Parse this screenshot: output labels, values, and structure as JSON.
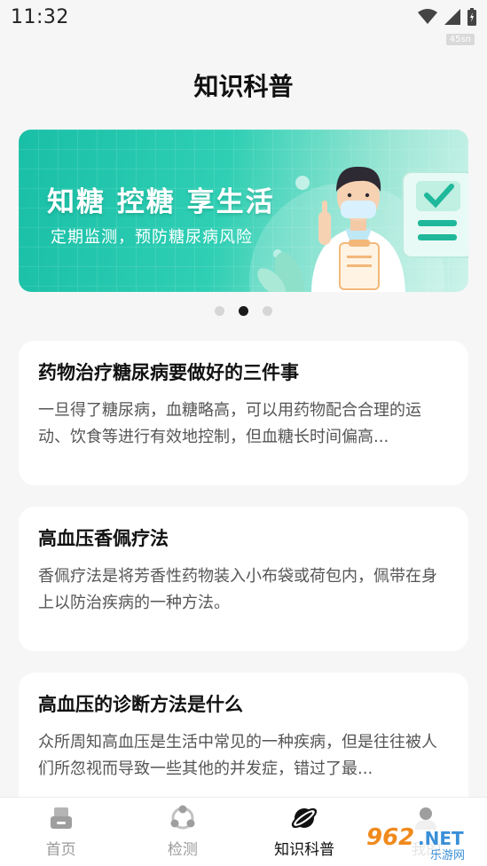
{
  "status_bar": {
    "time": "11:32",
    "badge": "45sn"
  },
  "page": {
    "title": "知识科普"
  },
  "banner": {
    "headline": "知糖 控糖 享生活",
    "subtitle": "定期监测，预防糖尿病风险",
    "accent": "#1fc4aa"
  },
  "carousel": {
    "count": 3,
    "active": 1
  },
  "articles": [
    {
      "title": "药物治疗糖尿病要做好的三件事",
      "summary": "一旦得了糖尿病，血糖略高，可以用药物配合合理的运动、饮食等进行有效地控制，但血糖长时间偏高..."
    },
    {
      "title": "高血压香佩疗法",
      "summary": "香佩疗法是将芳香性药物装入小布袋或荷包内，佩带在身上以防治疾病的一种方法。"
    },
    {
      "title": "高血压的诊断方法是什么",
      "summary": "众所周知高血压是生活中常见的一种疾病，但是往往被人们所忽视而导致一些其他的并发症，错过了最..."
    }
  ],
  "tabbar": {
    "items": [
      {
        "label": "首页",
        "icon": "home-icon"
      },
      {
        "label": "检测",
        "icon": "detect-icon"
      },
      {
        "label": "知识科普",
        "icon": "knowledge-icon"
      },
      {
        "label": "我的",
        "icon": "profile-icon"
      }
    ],
    "active": 2
  },
  "watermark": {
    "text": "962.NET",
    "subtext": "乐游网"
  }
}
